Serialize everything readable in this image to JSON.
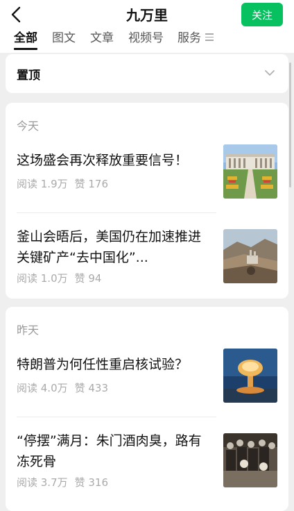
{
  "header": {
    "title": "九万里",
    "follow_label": "关注"
  },
  "tabs": [
    {
      "label": "全部",
      "active": true
    },
    {
      "label": "图文",
      "active": false
    },
    {
      "label": "文章",
      "active": false
    },
    {
      "label": "视频号",
      "active": false
    },
    {
      "label": "服务",
      "active": false
    }
  ],
  "pinned": {
    "label": "置顶"
  },
  "sections": [
    {
      "day": "今天",
      "articles": [
        {
          "title": "这场盛会再次释放重要信号！",
          "reads": "阅读 1.9万",
          "likes": "赞 176"
        },
        {
          "title": "釜山会晤后，美国仍在加速推进关键矿产“去中国化”...",
          "reads": "阅读 1.0万",
          "likes": "赞 94"
        }
      ]
    },
    {
      "day": "昨天",
      "articles": [
        {
          "title": "特朗普为何任性重启核试验？",
          "reads": "阅读 4.0万",
          "likes": "赞 433"
        },
        {
          "title": "“停摆”满月：朱门酒肉臭，路有冻死骨",
          "reads": "阅读 3.7万",
          "likes": "赞 316"
        }
      ]
    }
  ],
  "colors": {
    "accent": "#07c160",
    "background": "#efefef",
    "meta_text": "#aaaaaa"
  }
}
